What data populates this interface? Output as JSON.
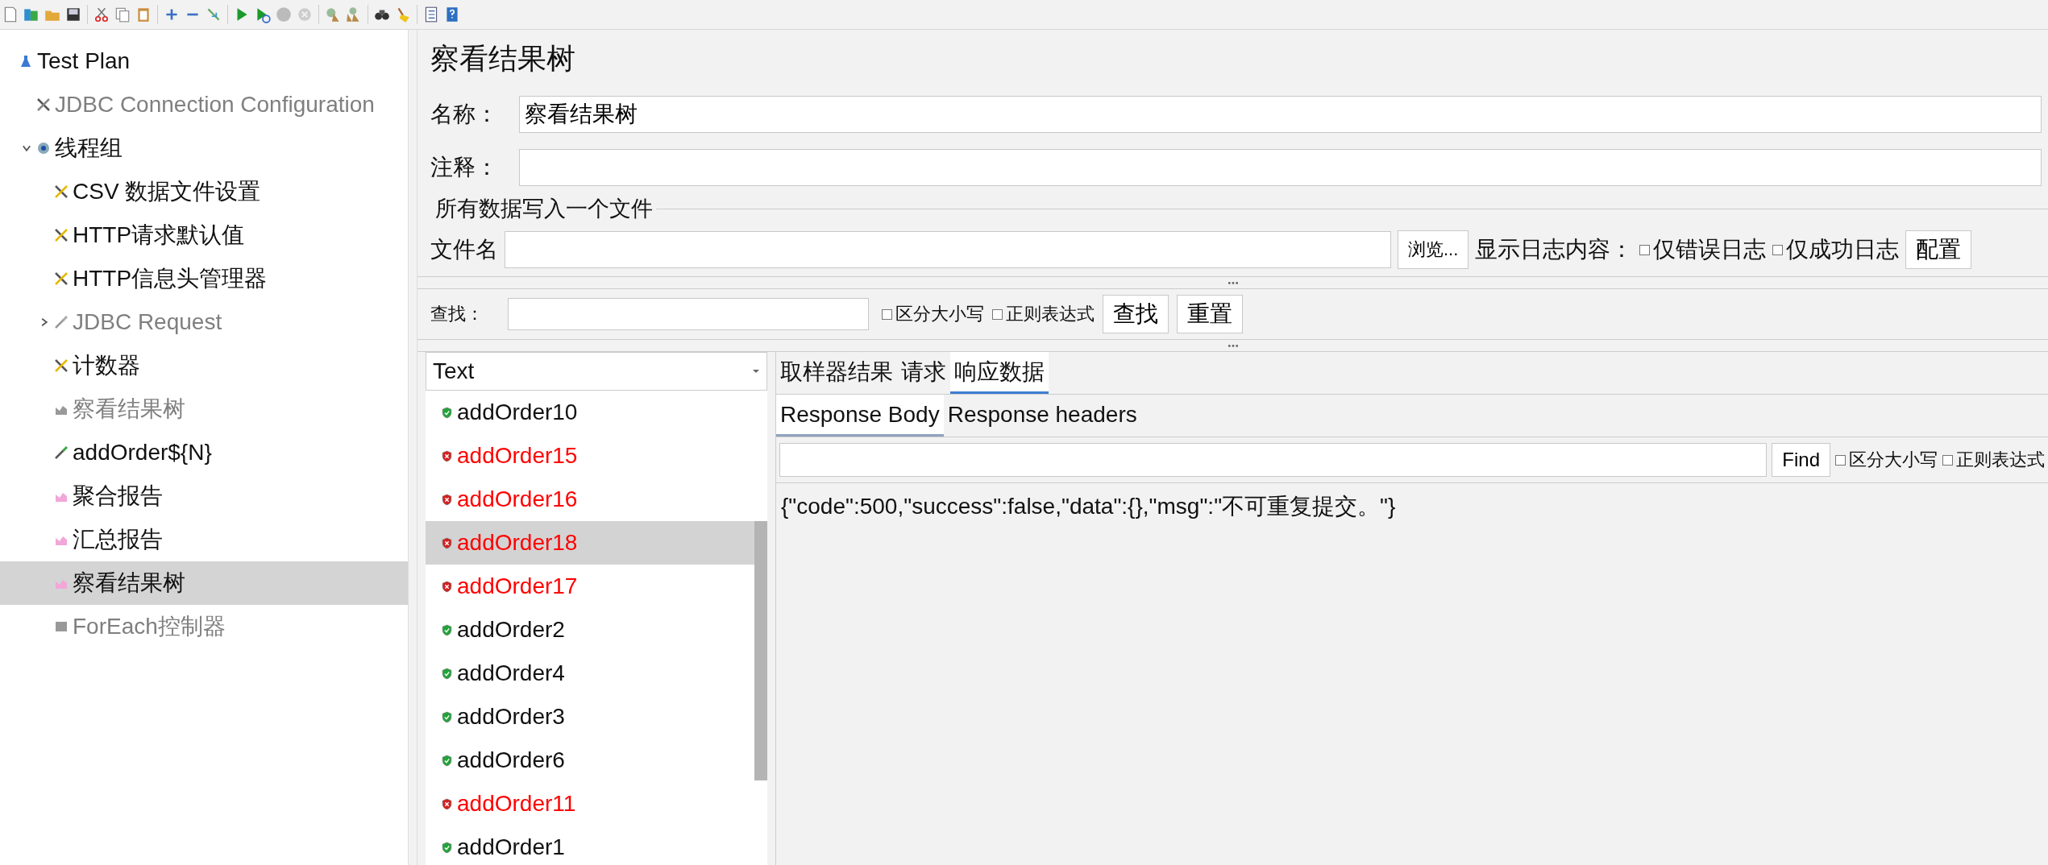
{
  "tree": [
    {
      "label": "Test Plan",
      "kind": "plan",
      "disabled": false,
      "selected": false,
      "children": [
        {
          "label": "JDBC Connection Configuration",
          "kind": "config",
          "disabled": true,
          "selected": false
        },
        {
          "label": "线程组",
          "kind": "thread-group",
          "disabled": false,
          "selected": false,
          "expanded": true,
          "children": [
            {
              "label": "CSV 数据文件设置",
              "kind": "config",
              "disabled": false,
              "selected": false
            },
            {
              "label": "HTTP请求默认值",
              "kind": "config",
              "disabled": false,
              "selected": false
            },
            {
              "label": "HTTP信息头管理器",
              "kind": "config",
              "disabled": false,
              "selected": false
            },
            {
              "label": "JDBC Request",
              "kind": "sampler",
              "disabled": true,
              "selected": false,
              "expanded": false
            },
            {
              "label": "计数器",
              "kind": "config",
              "disabled": false,
              "selected": false
            },
            {
              "label": "察看结果树",
              "kind": "listener",
              "disabled": true,
              "selected": false
            },
            {
              "label": "addOrder${N}",
              "kind": "sampler",
              "disabled": false,
              "selected": false
            },
            {
              "label": "聚合报告",
              "kind": "listener",
              "disabled": false,
              "selected": false
            },
            {
              "label": "汇总报告",
              "kind": "listener",
              "disabled": false,
              "selected": false
            },
            {
              "label": "察看结果树",
              "kind": "listener",
              "disabled": false,
              "selected": true
            },
            {
              "label": "ForEach控制器",
              "kind": "controller",
              "disabled": true,
              "selected": false
            }
          ]
        }
      ]
    }
  ],
  "panel": {
    "title": "察看结果树",
    "name_label": "名称：",
    "name_value": "察看结果树",
    "comment_label": "注释：",
    "file_group": "所有数据写入一个文件",
    "filename_label": "文件名",
    "browse_button": "浏览...",
    "log_label": "显示日志内容：",
    "log_options": [
      {
        "label": "仅错误日志",
        "checked": false
      },
      {
        "label": "仅成功日志",
        "checked": false
      }
    ],
    "configure_button": "配置"
  },
  "search": {
    "label": "查找：",
    "options": [
      {
        "label": "区分大小写",
        "checked": false
      },
      {
        "label": "正则表达式",
        "checked": false
      }
    ],
    "find_button": "查找",
    "reset_button": "重置"
  },
  "results": {
    "renderer": "Text",
    "items": [
      {
        "name": "addOrder10",
        "success": true,
        "selected": false
      },
      {
        "name": "addOrder15",
        "success": false,
        "selected": false
      },
      {
        "name": "addOrder16",
        "success": false,
        "selected": false
      },
      {
        "name": "addOrder18",
        "success": false,
        "selected": true
      },
      {
        "name": "addOrder17",
        "success": false,
        "selected": false
      },
      {
        "name": "addOrder2",
        "success": true,
        "selected": false
      },
      {
        "name": "addOrder4",
        "success": true,
        "selected": false
      },
      {
        "name": "addOrder3",
        "success": true,
        "selected": false
      },
      {
        "name": "addOrder6",
        "success": true,
        "selected": false
      },
      {
        "name": "addOrder11",
        "success": false,
        "selected": false
      },
      {
        "name": "addOrder1",
        "success": true,
        "selected": false
      }
    ]
  },
  "detail": {
    "tabs": [
      {
        "label": "取样器结果",
        "selected": false
      },
      {
        "label": "请求",
        "selected": false
      },
      {
        "label": "响应数据",
        "selected": true
      }
    ],
    "subtabs": [
      {
        "label": "Response Body",
        "selected": true
      },
      {
        "label": "Response headers",
        "selected": false
      }
    ],
    "find_button": "Find",
    "options": [
      {
        "label": "区分大小写",
        "checked": false
      },
      {
        "label": "正则表达式",
        "checked": false
      }
    ],
    "body": "{\"code\":500,\"success\":false,\"data\":{},\"msg\":\"不可重复提交。\"}"
  }
}
